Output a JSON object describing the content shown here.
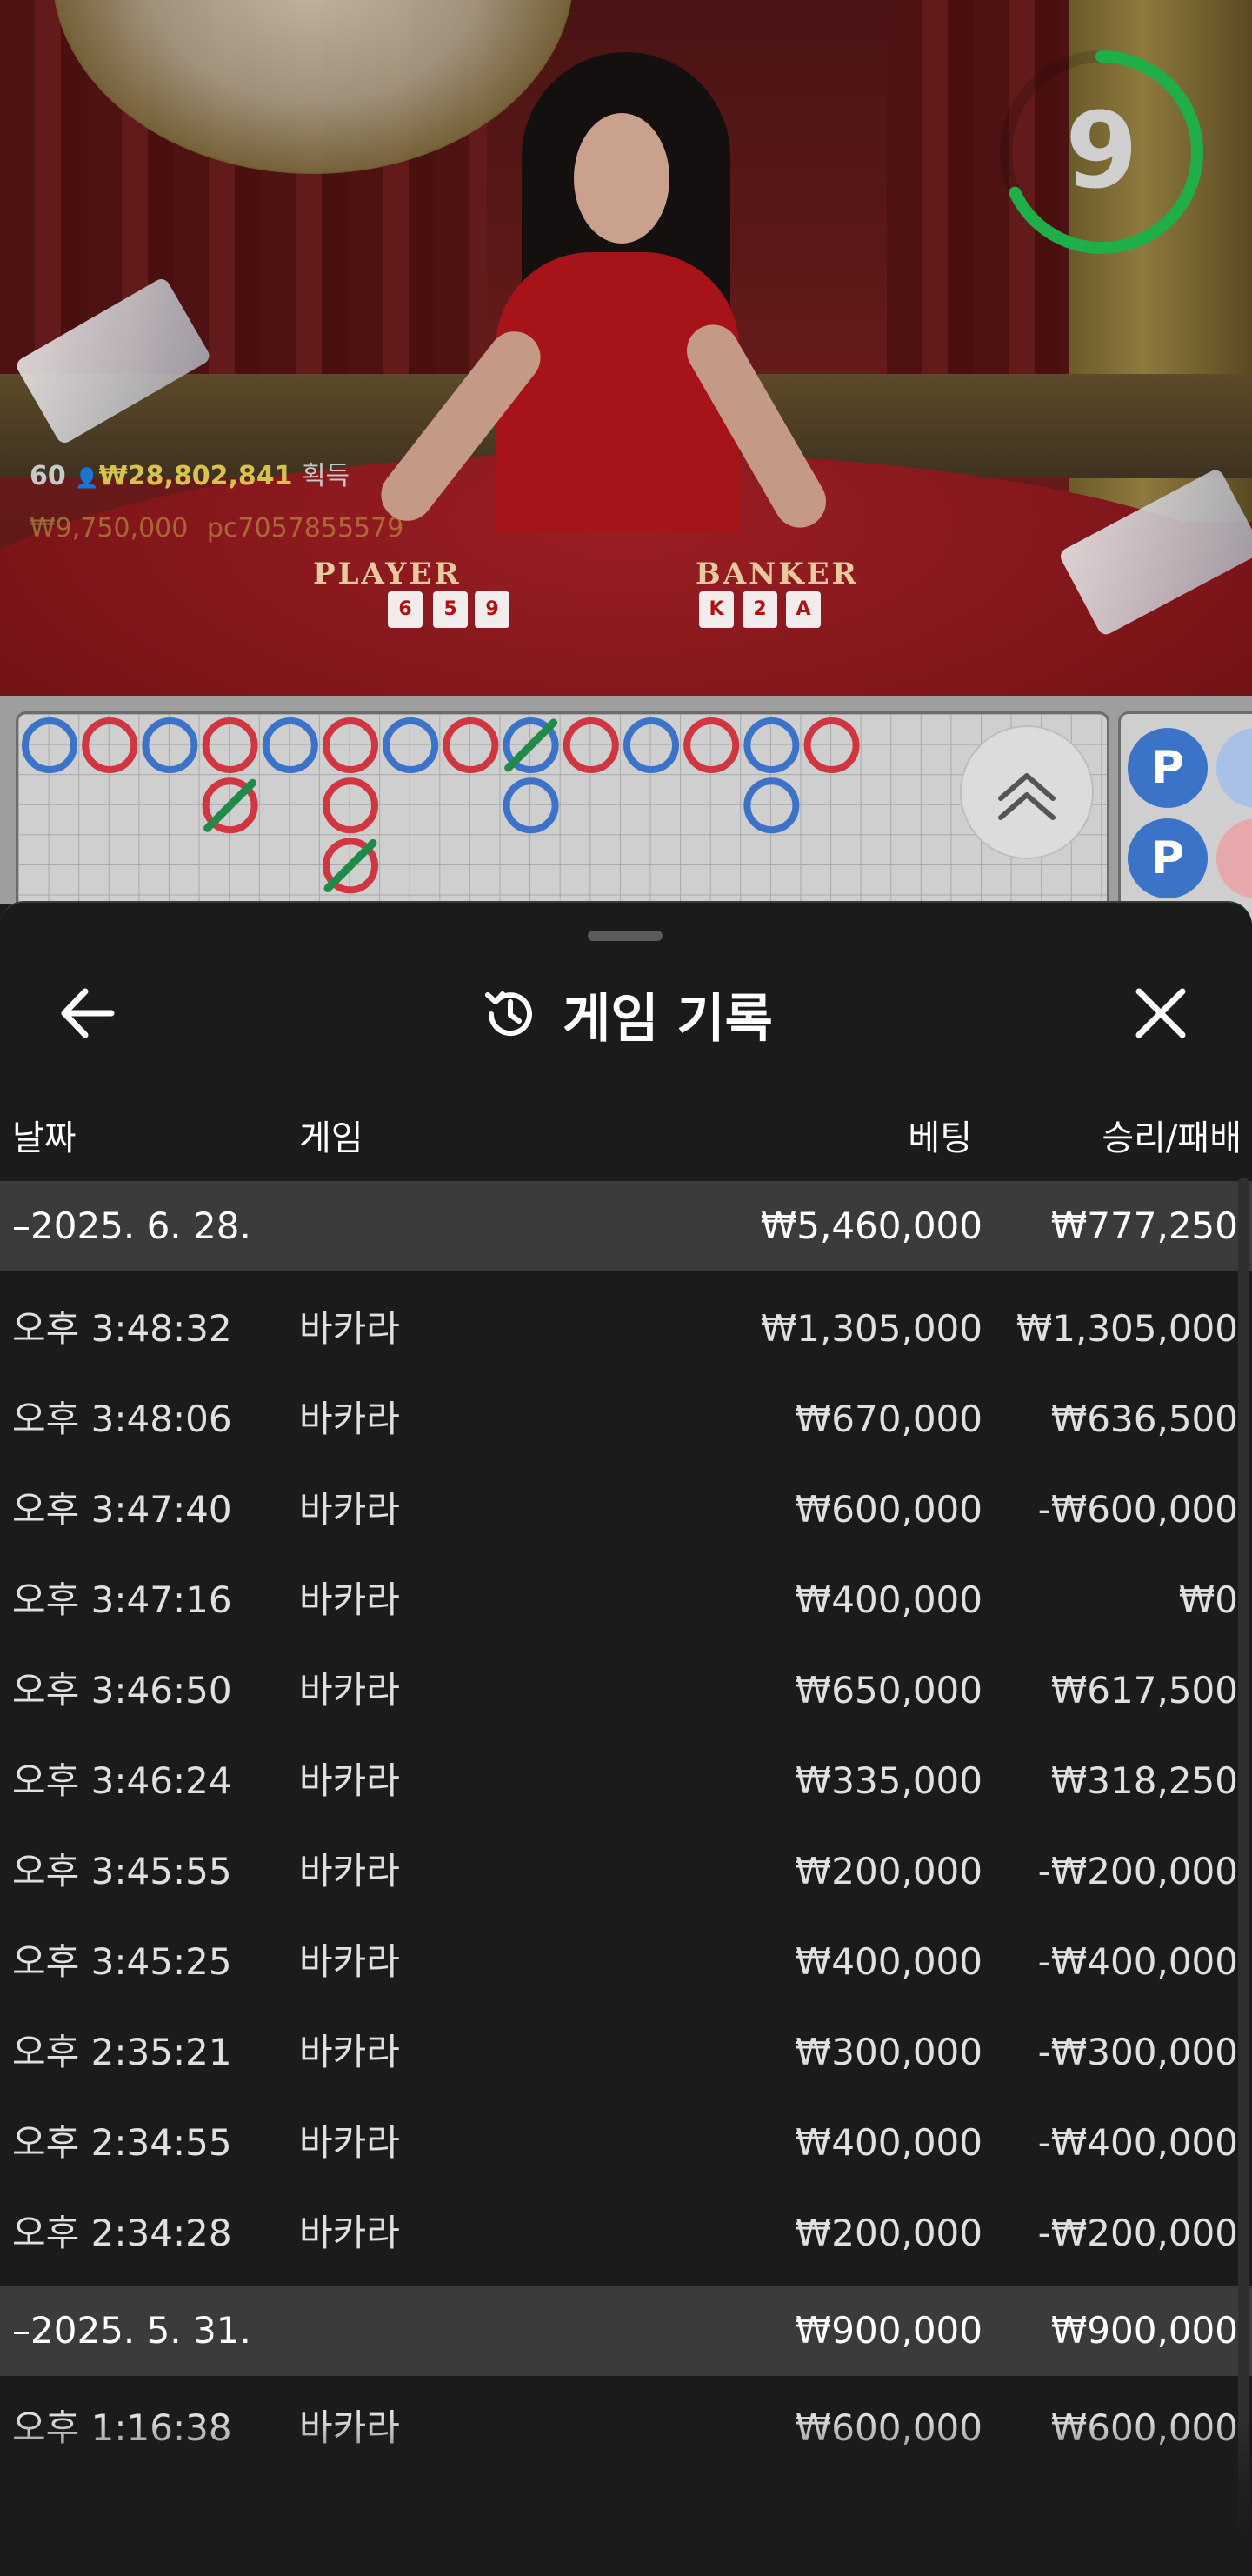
{
  "stream": {
    "table_labels": {
      "player": "PLAYER",
      "banker": "BANKER"
    },
    "timer": {
      "value": "9",
      "fraction": 0.68,
      "color": "#1fae4a"
    },
    "players": {
      "count": "60",
      "amount": "₩28,802,841",
      "suffix": "획득"
    },
    "winner": {
      "amount": "₩9,750,000",
      "user": "pc7057855579"
    },
    "cards": {
      "player": [
        "6",
        "5",
        "9"
      ],
      "banker": [
        "K",
        "2",
        "A"
      ]
    }
  },
  "roadmap": {
    "colors": {
      "player": "#3b73c8",
      "banker": "#d0363f",
      "tie": "#1f8a4a"
    },
    "bead_labels": [
      "P",
      "P"
    ]
  },
  "panel": {
    "title": "게임 기록",
    "icons": {
      "back": "arrow-left-icon",
      "close": "close-icon",
      "title": "history-icon"
    },
    "columns": {
      "date": "날짜",
      "game": "게임",
      "bet": "베팅",
      "result": "승리/패배"
    },
    "groups": [
      {
        "date": "–2025. 6. 28.",
        "bet": "₩5,460,000",
        "result": "₩777,250",
        "rows": [
          {
            "time": "오후 3:48:32",
            "game": "바카라",
            "bet": "₩1,305,000",
            "result": "₩1,305,000"
          },
          {
            "time": "오후 3:48:06",
            "game": "바카라",
            "bet": "₩670,000",
            "result": "₩636,500"
          },
          {
            "time": "오후 3:47:40",
            "game": "바카라",
            "bet": "₩600,000",
            "result": "-₩600,000"
          },
          {
            "time": "오후 3:47:16",
            "game": "바카라",
            "bet": "₩400,000",
            "result": "₩0"
          },
          {
            "time": "오후 3:46:50",
            "game": "바카라",
            "bet": "₩650,000",
            "result": "₩617,500"
          },
          {
            "time": "오후 3:46:24",
            "game": "바카라",
            "bet": "₩335,000",
            "result": "₩318,250"
          },
          {
            "time": "오후 3:45:55",
            "game": "바카라",
            "bet": "₩200,000",
            "result": "-₩200,000"
          },
          {
            "time": "오후 3:45:25",
            "game": "바카라",
            "bet": "₩400,000",
            "result": "-₩400,000"
          },
          {
            "time": "오후 2:35:21",
            "game": "바카라",
            "bet": "₩300,000",
            "result": "-₩300,000"
          },
          {
            "time": "오후 2:34:55",
            "game": "바카라",
            "bet": "₩400,000",
            "result": "-₩400,000"
          },
          {
            "time": "오후 2:34:28",
            "game": "바카라",
            "bet": "₩200,000",
            "result": "-₩200,000"
          }
        ]
      },
      {
        "date": "–2025. 5. 31.",
        "bet": "₩900,000",
        "result": "₩900,000",
        "rows": [
          {
            "time": "오후 1:16:38",
            "game": "바카라",
            "bet": "₩600,000",
            "result": "₩600,000"
          }
        ]
      }
    ]
  }
}
